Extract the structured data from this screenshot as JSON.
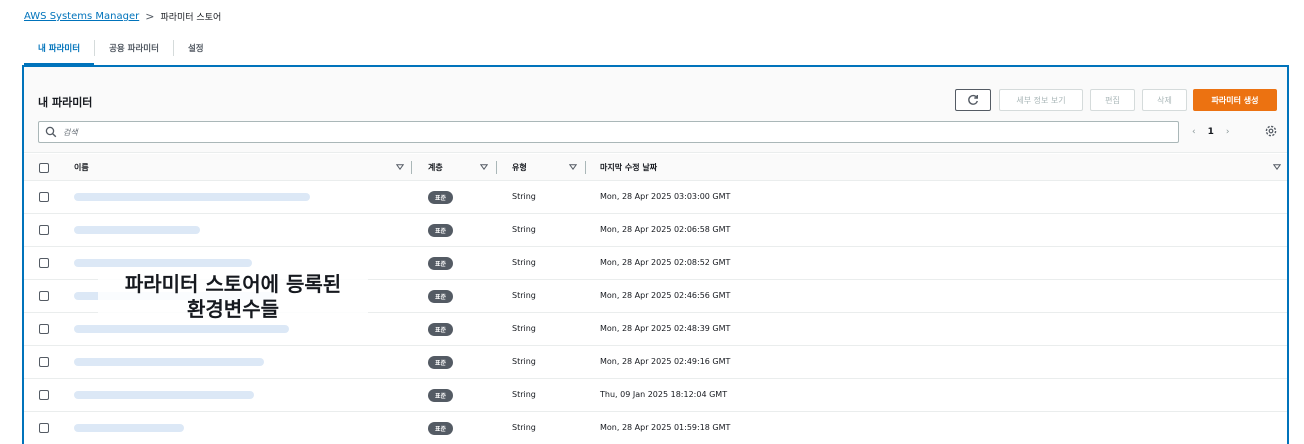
{
  "breadcrumb": {
    "root": "AWS Systems Manager",
    "separator": ">",
    "current": "파라미터 스토어"
  },
  "tabs": [
    {
      "label": "내 파라미터",
      "active": true
    },
    {
      "label": "공용 파라미터",
      "active": false
    },
    {
      "label": "설정",
      "active": false
    }
  ],
  "panel": {
    "title": "내 파라미터",
    "buttons": {
      "details": "세부 정보 보기",
      "edit": "편집",
      "delete": "삭제",
      "create": "파라미터 생성"
    }
  },
  "search": {
    "placeholder": "검색"
  },
  "pagination": {
    "page": "1"
  },
  "columns": {
    "name": "이름",
    "tier": "계층",
    "type": "유형",
    "modified": "마지막 수정 날짜"
  },
  "rows": [
    {
      "tier": "표준",
      "type": "String",
      "date": "Mon, 28 Apr 2025 03:03:00 GMT"
    },
    {
      "tier": "표준",
      "type": "String",
      "date": "Mon, 28 Apr 2025 02:06:58 GMT"
    },
    {
      "tier": "표준",
      "type": "String",
      "date": "Mon, 28 Apr 2025 02:08:52 GMT"
    },
    {
      "tier": "표준",
      "type": "String",
      "date": "Mon, 28 Apr 2025 02:46:56 GMT"
    },
    {
      "tier": "표준",
      "type": "String",
      "date": "Mon, 28 Apr 2025 02:48:39 GMT"
    },
    {
      "tier": "표준",
      "type": "String",
      "date": "Mon, 28 Apr 2025 02:49:16 GMT"
    },
    {
      "tier": "표준",
      "type": "String",
      "date": "Thu, 09 Jan 2025 18:12:04 GMT"
    },
    {
      "tier": "표준",
      "type": "String",
      "date": "Mon, 28 Apr 2025 01:59:18 GMT"
    }
  ],
  "overlay": {
    "line1": "파라미터 스토어에 등록된",
    "line2": "환경변수들"
  },
  "colors": {
    "accent": "#0073bb",
    "primary_button": "#ec7211",
    "badge": "#545b64"
  }
}
